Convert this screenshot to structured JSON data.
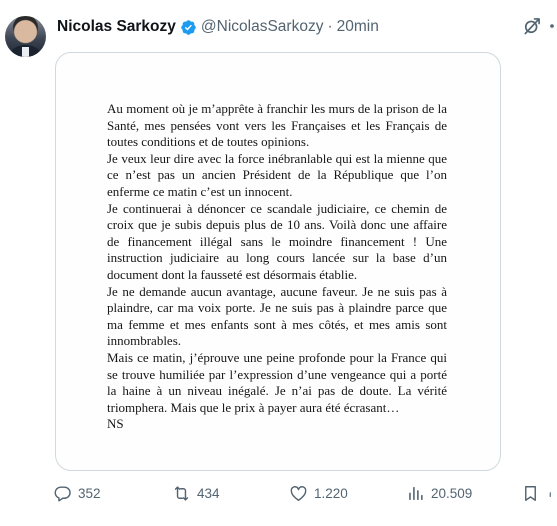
{
  "author": {
    "name": "Nicolas Sarkozy",
    "handle": "@NicolasSarkozy",
    "separator": "·",
    "time": "20min"
  },
  "letter": {
    "paragraphs": [
      "Au moment où je m’apprête à franchir les murs de la prison de la Santé, mes pensées vont vers les Françaises et les Français de toutes conditions et de toutes opinions.",
      "Je veux leur dire avec la force inébranlable qui est la mienne que ce n’est pas un ancien Président de la République que l’on enferme ce matin c’est un innocent.",
      "Je continuerai à dénoncer ce scandale judiciaire, ce chemin de croix que je subis depuis plus de 10 ans. Voilà donc une affaire de financement illégal sans le moindre financement ! Une instruction judiciaire au long cours lancée sur la base d’un document dont la fausseté est désormais établie.",
      "Je ne demande aucun avantage, aucune faveur. Je ne suis pas à plaindre, car ma voix porte. Je ne suis pas à plaindre parce que ma femme et mes enfants sont à mes côtés, et mes amis sont innombrables.",
      "Mais ce matin, j’éprouve une peine profonde pour la France qui se trouve humiliée par l’expression d’une vengeance qui a porté la haine à un niveau inégalé. Je n’ai pas de doute. La vérité triomphera. Mais que le prix à payer aura été écrasant…",
      "NS"
    ]
  },
  "actions": {
    "replies": "352",
    "reposts": "434",
    "likes": "1.220",
    "views": "20.509"
  },
  "icons": {
    "verified": "verified-badge-icon",
    "grok": "grok-icon",
    "reply": "reply-icon",
    "repost": "repost-icon",
    "like": "heart-icon",
    "views": "views-icon",
    "bookmark": "bookmark-icon",
    "share": "share-icon"
  },
  "colors": {
    "verified": "#1d9bf0",
    "muted": "#536471",
    "text": "#0f1419",
    "border": "#cfd9de"
  }
}
